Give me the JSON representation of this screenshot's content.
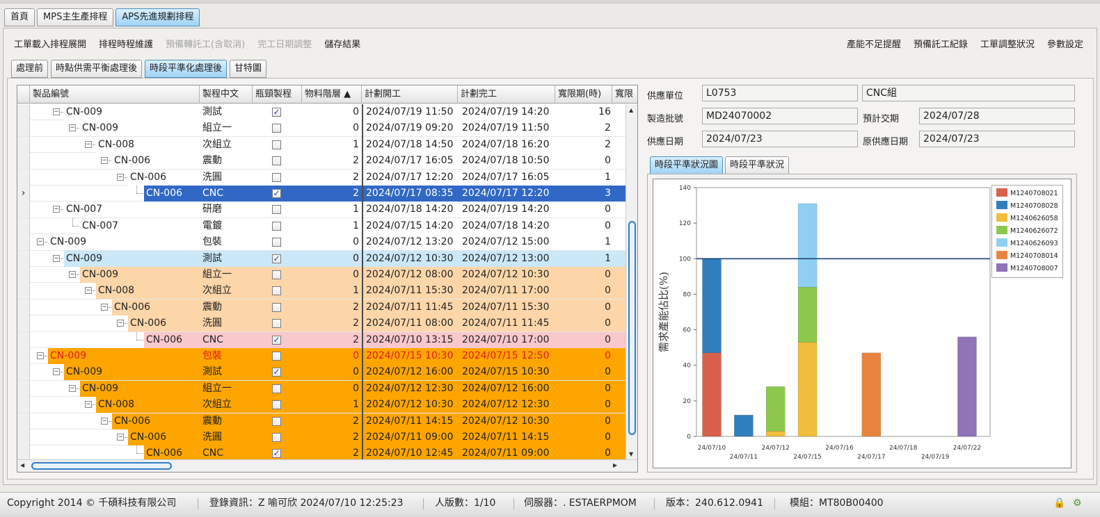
{
  "main_tabs": [
    {
      "label": "首頁",
      "active": false
    },
    {
      "label": "MPS主生產排程",
      "active": false
    },
    {
      "label": "APS先進規劃排程",
      "active": true
    }
  ],
  "toolbar_left": [
    {
      "label": "工單載入排程展開",
      "enabled": true
    },
    {
      "label": "排程時程維護",
      "enabled": true
    },
    {
      "label": "預備轉託工(含取消)",
      "enabled": false
    },
    {
      "label": "完工日期調整",
      "enabled": false
    },
    {
      "label": "儲存結果",
      "enabled": true
    }
  ],
  "toolbar_right": [
    {
      "label": "產能不足提醒"
    },
    {
      "label": "預備託工紀錄"
    },
    {
      "label": "工單調整狀況"
    },
    {
      "label": "參數設定"
    }
  ],
  "sub_tabs": [
    {
      "label": "處理前",
      "active": false
    },
    {
      "label": "時點供需平衡處理後",
      "active": false
    },
    {
      "label": "時段平準化處理後",
      "active": true
    },
    {
      "label": "甘特圖",
      "active": false
    }
  ],
  "grid": {
    "columns": [
      "製品編號",
      "製程中文",
      "瓶頸製程",
      "物料階層 ▲",
      "計劃開工",
      "計劃完工",
      "寬限期(時)",
      "寬限"
    ],
    "rows": [
      {
        "level": 1,
        "expand": true,
        "code": "CN-009",
        "op": "測試",
        "bottleneck": true,
        "layer": "0",
        "start": "2024/07/19 11:50",
        "end": "2024/07/19 14:20",
        "grace": "16",
        "style": "white"
      },
      {
        "level": 2,
        "expand": true,
        "code": "CN-009",
        "op": "組立一",
        "bottleneck": false,
        "layer": "0",
        "start": "2024/07/19 09:20",
        "end": "2024/07/19 11:50",
        "grace": "2",
        "style": "white"
      },
      {
        "level": 3,
        "expand": true,
        "code": "CN-008",
        "op": "次組立",
        "bottleneck": false,
        "layer": "1",
        "start": "2024/07/18 14:50",
        "end": "2024/07/18 16:20",
        "grace": "2",
        "style": "white"
      },
      {
        "level": 4,
        "expand": true,
        "code": "CN-006",
        "op": "震動",
        "bottleneck": false,
        "layer": "2",
        "start": "2024/07/17 16:05",
        "end": "2024/07/18 10:50",
        "grace": "0",
        "style": "white"
      },
      {
        "level": 5,
        "expand": true,
        "code": "CN-006",
        "op": "洗圓",
        "bottleneck": false,
        "layer": "2",
        "start": "2024/07/17 12:20",
        "end": "2024/07/17 16:05",
        "grace": "1",
        "style": "white"
      },
      {
        "level": 6,
        "expand": false,
        "code": "CN-006",
        "op": "CNC",
        "bottleneck": true,
        "layer": "2",
        "start": "2024/07/17 08:35",
        "end": "2024/07/17 12:20",
        "grace": "3",
        "style": "selected"
      },
      {
        "level": 1,
        "expand": true,
        "code": "CN-007",
        "op": "研磨",
        "bottleneck": false,
        "layer": "1",
        "start": "2024/07/18 14:20",
        "end": "2024/07/19 14:20",
        "grace": "0",
        "style": "white"
      },
      {
        "level": 2,
        "expand": false,
        "code": "CN-007",
        "op": "電鍍",
        "bottleneck": false,
        "layer": "1",
        "start": "2024/07/15 14:20",
        "end": "2024/07/18 14:20",
        "grace": "0",
        "style": "white"
      },
      {
        "level": 0,
        "expand": true,
        "code": "CN-009",
        "op": "包裝",
        "bottleneck": false,
        "layer": "0",
        "start": "2024/07/12 13:20",
        "end": "2024/07/12 15:00",
        "grace": "1",
        "style": "white"
      },
      {
        "level": 1,
        "expand": true,
        "code": "CN-009",
        "op": "測試",
        "bottleneck": true,
        "layer": "0",
        "start": "2024/07/12 10:30",
        "end": "2024/07/12 13:00",
        "grace": "1",
        "style": "lightblue"
      },
      {
        "level": 2,
        "expand": true,
        "code": "CN-009",
        "op": "組立一",
        "bottleneck": false,
        "layer": "0",
        "start": "2024/07/12 08:00",
        "end": "2024/07/12 10:30",
        "grace": "0",
        "style": "peach"
      },
      {
        "level": 3,
        "expand": true,
        "code": "CN-008",
        "op": "次組立",
        "bottleneck": false,
        "layer": "1",
        "start": "2024/07/11 15:30",
        "end": "2024/07/11 17:00",
        "grace": "0",
        "style": "peach"
      },
      {
        "level": 4,
        "expand": true,
        "code": "CN-006",
        "op": "震動",
        "bottleneck": false,
        "layer": "2",
        "start": "2024/07/11 11:45",
        "end": "2024/07/11 15:30",
        "grace": "0",
        "style": "peach"
      },
      {
        "level": 5,
        "expand": true,
        "code": "CN-006",
        "op": "洗圓",
        "bottleneck": false,
        "layer": "2",
        "start": "2024/07/11 08:00",
        "end": "2024/07/11 11:45",
        "grace": "0",
        "style": "peach"
      },
      {
        "level": 6,
        "expand": false,
        "code": "CN-006",
        "op": "CNC",
        "bottleneck": true,
        "layer": "2",
        "start": "2024/07/10 13:15",
        "end": "2024/07/10 17:00",
        "grace": "0",
        "style": "pink"
      },
      {
        "level": 0,
        "expand": true,
        "code": "CN-009",
        "op": "包裝",
        "bottleneck": false,
        "layer": "0",
        "start": "2024/07/15 10:30",
        "end": "2024/07/15 12:50",
        "grace": "0",
        "style": "orange-red"
      },
      {
        "level": 1,
        "expand": true,
        "code": "CN-009",
        "op": "測試",
        "bottleneck": true,
        "layer": "0",
        "start": "2024/07/12 16:00",
        "end": "2024/07/15 10:30",
        "grace": "0",
        "style": "orange"
      },
      {
        "level": 2,
        "expand": true,
        "code": "CN-009",
        "op": "組立一",
        "bottleneck": false,
        "layer": "0",
        "start": "2024/07/12 12:30",
        "end": "2024/07/12 16:00",
        "grace": "0",
        "style": "orange"
      },
      {
        "level": 3,
        "expand": true,
        "code": "CN-008",
        "op": "次組立",
        "bottleneck": false,
        "layer": "1",
        "start": "2024/07/12 10:30",
        "end": "2024/07/12 12:30",
        "grace": "0",
        "style": "orange"
      },
      {
        "level": 4,
        "expand": true,
        "code": "CN-006",
        "op": "震動",
        "bottleneck": false,
        "layer": "2",
        "start": "2024/07/11 14:15",
        "end": "2024/07/12 10:30",
        "grace": "0",
        "style": "orange"
      },
      {
        "level": 5,
        "expand": true,
        "code": "CN-006",
        "op": "洗圓",
        "bottleneck": false,
        "layer": "2",
        "start": "2024/07/11 09:00",
        "end": "2024/07/11 14:15",
        "grace": "0",
        "style": "orange"
      },
      {
        "level": 6,
        "expand": false,
        "code": "CN-006",
        "op": "CNC",
        "bottleneck": true,
        "layer": "2",
        "start": "2024/07/10 12:45",
        "end": "2024/07/11 09:00",
        "grace": "0",
        "style": "orange"
      }
    ]
  },
  "form": {
    "supplier_label": "供應單位",
    "supplier_value": "L0753",
    "supplier_name": "CNC組",
    "batch_label": "製造批號",
    "batch_value": "MD24070002",
    "due_label": "預計交期",
    "due_value": "2024/07/28",
    "supply_date_label": "供應日期",
    "supply_date_value": "2024/07/23",
    "orig_supply_label": "原供應日期",
    "orig_supply_value": "2024/07/23"
  },
  "chart_tabs": [
    {
      "label": "時段平準狀況圖",
      "active": true
    },
    {
      "label": "時段平準狀況",
      "active": false
    }
  ],
  "chart_data": {
    "type": "bar",
    "stacked": true,
    "ylabel": "需求產能佔比(%)",
    "xlabel": "",
    "ylim": [
      0,
      140
    ],
    "yticks": [
      "0",
      "20",
      "40",
      "60",
      "80",
      "100",
      "120",
      "140"
    ],
    "xticks_top": [
      "24/07/10",
      "24/07/12",
      "24/07/16",
      "24/07/18",
      "24/07/22"
    ],
    "xticks_bottom": [
      "24/07/11",
      "24/07/15",
      "24/07/17",
      "24/07/19"
    ],
    "reference_line": 100,
    "legend_position": "top-right",
    "series": [
      {
        "name": "M1240708021",
        "color": "#d9614c"
      },
      {
        "name": "M1240708028",
        "color": "#2f7fbf"
      },
      {
        "name": "M1240626058",
        "color": "#f0be3c"
      },
      {
        "name": "M1240626072",
        "color": "#8cc84e"
      },
      {
        "name": "M1240626093",
        "color": "#8fd0f2"
      },
      {
        "name": "M1240708014",
        "color": "#e8843f"
      },
      {
        "name": "M1240708007",
        "color": "#9173b8"
      }
    ],
    "bars": [
      {
        "category": "24/07/10",
        "segments": [
          {
            "series": "M1240708021",
            "value": 47
          },
          {
            "series": "M1240708028",
            "value": 53
          }
        ]
      },
      {
        "category": "24/07/11",
        "segments": [
          {
            "series": "M1240708028",
            "value": 12
          }
        ]
      },
      {
        "category": "24/07/12",
        "segments": [
          {
            "series": "M1240626058",
            "value": 3
          },
          {
            "series": "M1240626072",
            "value": 25
          }
        ]
      },
      {
        "category": "24/07/15",
        "segments": [
          {
            "series": "M1240626058",
            "value": 53
          },
          {
            "series": "M1240626072",
            "value": 31
          },
          {
            "series": "M1240626093",
            "value": 47
          }
        ]
      },
      {
        "category": "24/07/17",
        "segments": [
          {
            "series": "M1240708014",
            "value": 47
          }
        ]
      },
      {
        "category": "24/07/22",
        "segments": [
          {
            "series": "M1240708007",
            "value": 56
          }
        ]
      }
    ]
  },
  "status": {
    "copyright": "Copyright 2014 © 千碩科技有限公司",
    "login": "登錄資訊：Z 喻可欣 2024/07/10 12:25:23",
    "users": "人版數：1/10",
    "server": "伺服器：. ESTAERPMOM",
    "version": "版本：240.612.0941",
    "module": "模組：MT80B00400"
  }
}
